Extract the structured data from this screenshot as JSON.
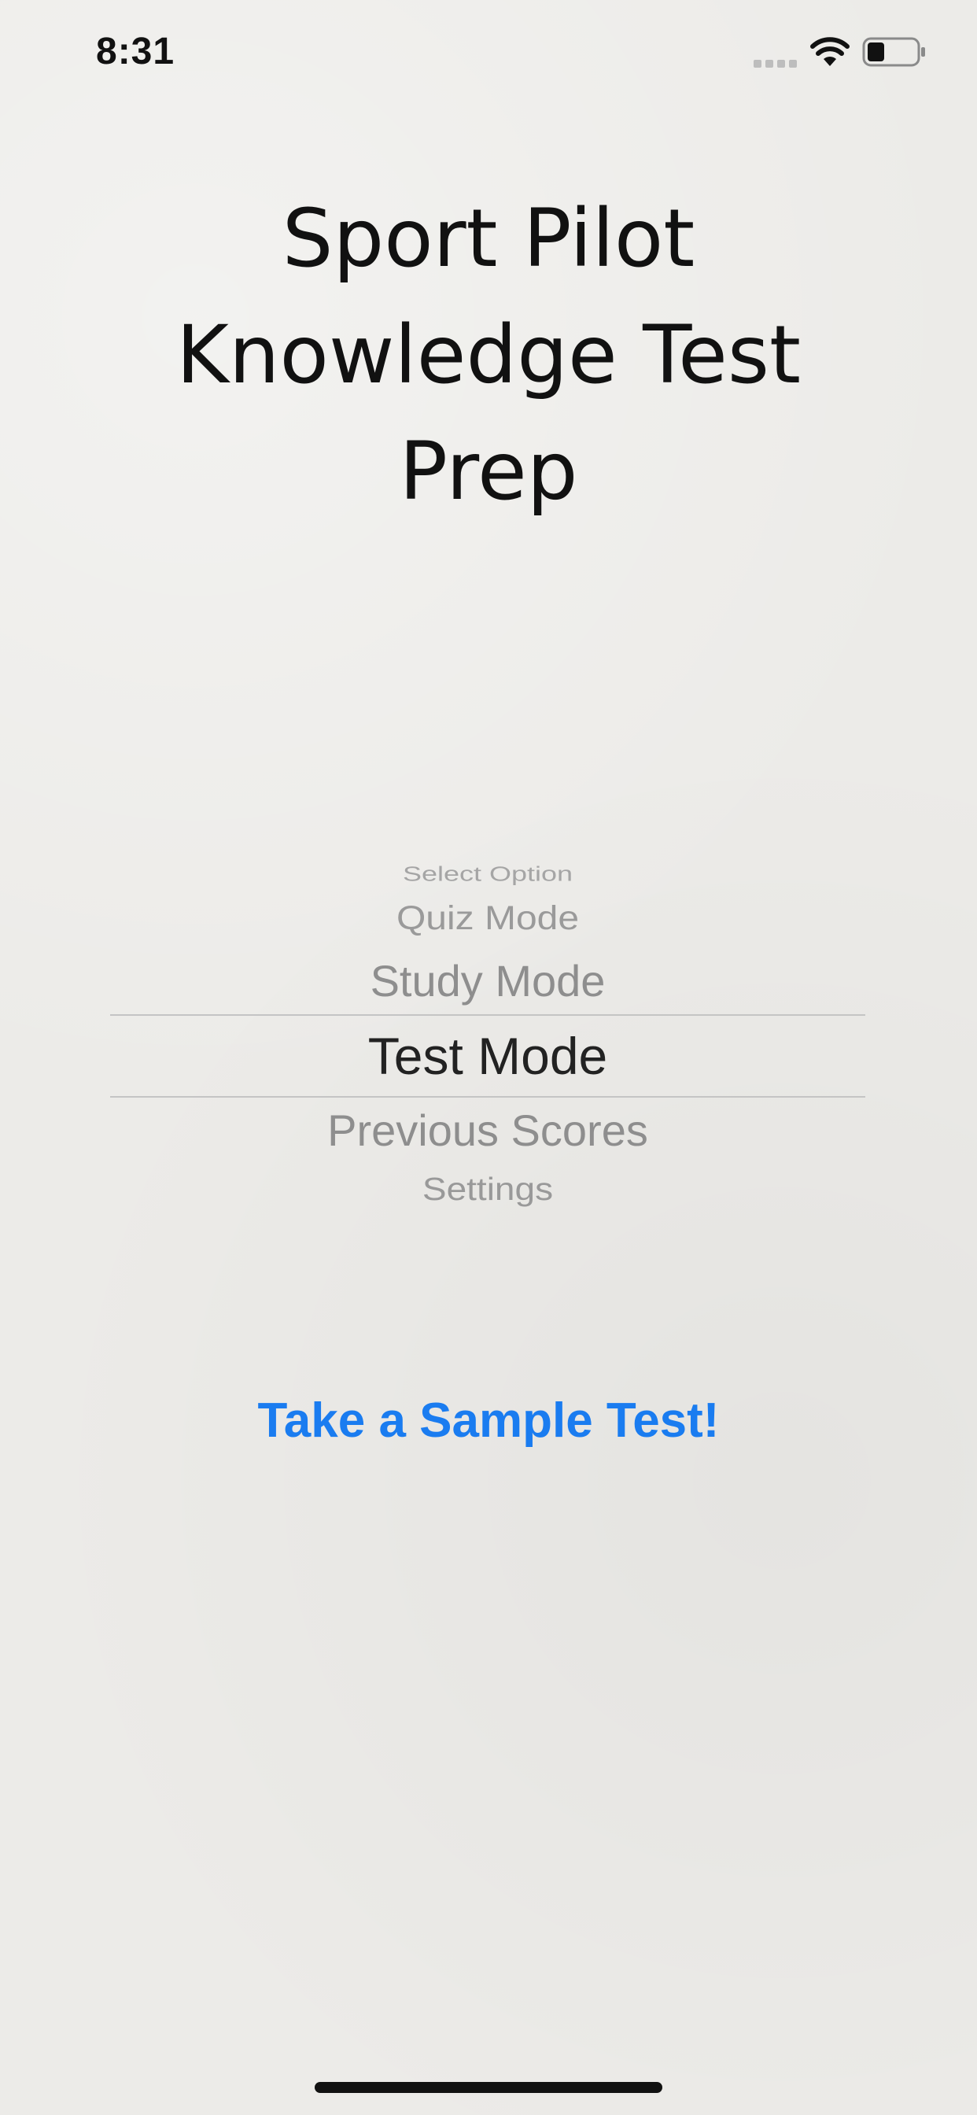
{
  "status_bar": {
    "time": "8:31",
    "signal_icon": "signal-dots-icon",
    "wifi_icon": "wifi-icon",
    "battery_icon": "battery-icon",
    "battery_level": 0.35
  },
  "title": {
    "lines": [
      "Sport Pilot",
      "Knowledge Test",
      "Prep"
    ]
  },
  "picker": {
    "items": [
      "Select Option",
      "Quiz Mode",
      "Study Mode",
      "Test Mode",
      "Previous Scores",
      "Settings"
    ],
    "selected": "Test Mode"
  },
  "sample_test": {
    "label": "Take a Sample Test!"
  },
  "colors": {
    "accent": "#1a7cf0",
    "background": "#ecebe8"
  }
}
